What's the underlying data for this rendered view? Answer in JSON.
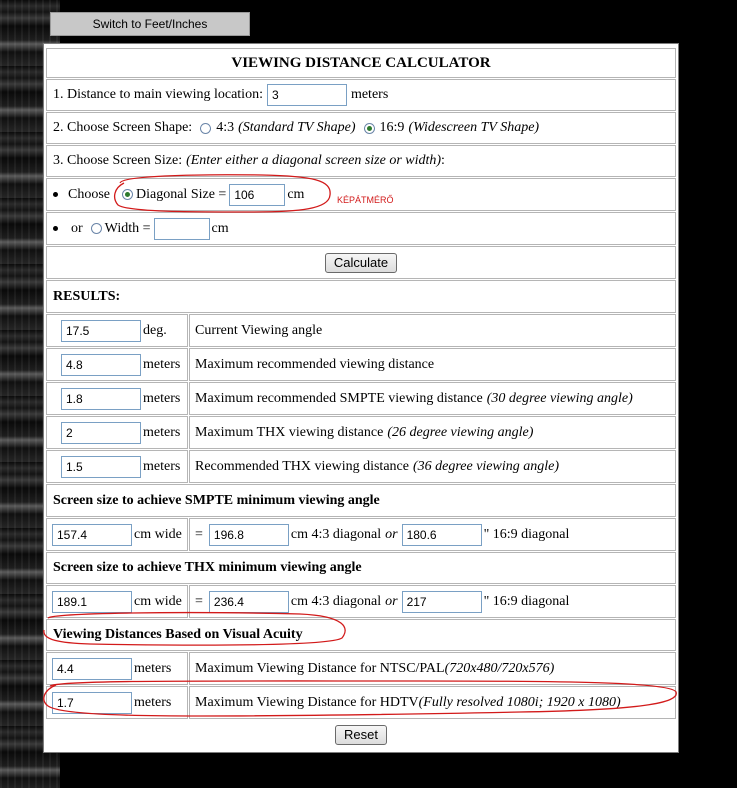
{
  "switch_button": "Switch to Feet/Inches",
  "title": "VIEWING DISTANCE CALCULATOR",
  "distance": {
    "label": "1. Distance to main viewing location:",
    "value": "3",
    "unit": "meters"
  },
  "shape": {
    "label": "2. Choose Screen Shape:",
    "opt1_value": "4:3",
    "opt1_desc": "(Standard TV Shape)",
    "opt2_value": "16:9",
    "opt2_desc": "(Widescreen TV Shape)"
  },
  "size": {
    "label": "3. Choose Screen Size:",
    "hint": "(Enter either a diagonal screen size or width)",
    "hint_end": ":",
    "choose": "Choose",
    "diag_label": "Diagonal Size =",
    "diag_value": "106",
    "diag_unit": "cm",
    "or": "or",
    "width_label": "Width =",
    "width_value": "",
    "width_unit": "cm"
  },
  "calculate_button": "Calculate",
  "results_heading": "RESULTS:",
  "results": [
    {
      "value": "17.5",
      "unit": "deg.",
      "desc": "Current Viewing angle",
      "note": ""
    },
    {
      "value": "4.8",
      "unit": "meters",
      "desc": "Maximum recommended viewing distance",
      "note": ""
    },
    {
      "value": "1.8",
      "unit": "meters",
      "desc": "Maximum recommended SMPTE viewing distance",
      "note": "(30 degree viewing angle)"
    },
    {
      "value": "2",
      "unit": "meters",
      "desc": "Maximum THX viewing distance",
      "note": "(26 degree viewing angle)"
    },
    {
      "value": "1.5",
      "unit": "meters",
      "desc": "Recommended THX viewing distance",
      "note": "(36 degree viewing angle)"
    }
  ],
  "smpte": {
    "heading": "Screen size to achieve SMPTE minimum viewing angle",
    "width": "157.4",
    "width_unit": "cm wide",
    "eq": "=",
    "diag43": "196.8",
    "diag43_unit": "cm 4:3 diagonal",
    "or": "or",
    "diag169": "180.6",
    "diag169_unit": "\" 16:9 diagonal"
  },
  "thx": {
    "heading": "Screen size to achieve THX minimum viewing angle",
    "width": "189.1",
    "width_unit": "cm wide",
    "eq": "=",
    "diag43": "236.4",
    "diag43_unit": "cm 4:3 diagonal",
    "or": "or",
    "diag169": "217",
    "diag169_unit": "\" 16:9 diagonal"
  },
  "acuity": {
    "heading": "Viewing Distances Based on Visual Acuity",
    "rows": [
      {
        "value": "4.4",
        "unit": "meters",
        "desc": "Maximum Viewing Distance for NTSC/PAL",
        "note": "(720x480/720x576)"
      },
      {
        "value": "1.7",
        "unit": "meters",
        "desc": "Maximum Viewing Distance for HDTV",
        "note": "(Fully resolved 1080i; 1920 x 1080)"
      }
    ]
  },
  "reset_button": "Reset",
  "annotation_label": "KÉPÁTMÉRŐ",
  "colors": {
    "annotation": "#d21a1a",
    "radio_selected": "#2d7a2d",
    "input_border": "#7aa0c4"
  }
}
